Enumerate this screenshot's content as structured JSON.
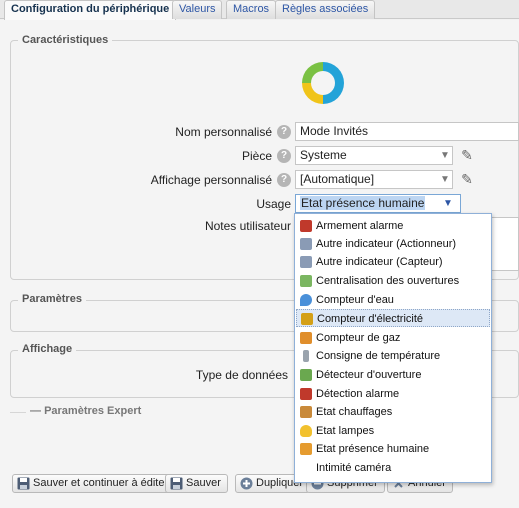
{
  "tabs": [
    {
      "label": "Configuration du périphérique",
      "active": true
    },
    {
      "label": "Valeurs",
      "active": false
    },
    {
      "label": "Macros",
      "active": false
    },
    {
      "label": "Règles associées",
      "active": false
    }
  ],
  "sections": {
    "caracteristiques": "Caractéristiques",
    "parametres": "Paramètres",
    "affichage": "Affichage",
    "expert": "Paramètres Expert"
  },
  "form": {
    "nom_label": "Nom personnalisé",
    "nom_value": "Mode Invités",
    "piece_label": "Pièce",
    "piece_value": "Systeme",
    "affichage_label": "Affichage personnalisé",
    "affichage_value": "[Automatique]",
    "usage_label": "Usage",
    "usage_value": "Etat présence humaine",
    "notes_label": "Notes utilisateur",
    "type_label": "Type de données",
    "help_glyph": "?"
  },
  "usage_options": [
    {
      "label": "Armement alarme",
      "icon": "alarm-arm-icon",
      "color": "#c0392b"
    },
    {
      "label": "Autre indicateur (Actionneur)",
      "icon": "generic-actuator-icon",
      "color": "#8a9bb5"
    },
    {
      "label": "Autre indicateur (Capteur)",
      "icon": "generic-sensor-icon",
      "color": "#8a9bb5"
    },
    {
      "label": "Centralisation des ouvertures",
      "icon": "openings-central-icon",
      "color": "#7bb661"
    },
    {
      "label": "Compteur d'eau",
      "icon": "water-meter-icon",
      "color": "#4a90d9"
    },
    {
      "label": "Compteur d'électricité",
      "icon": "electricity-meter-icon",
      "color": "#d4a017",
      "highlighted": true
    },
    {
      "label": "Compteur de gaz",
      "icon": "gas-meter-icon",
      "color": "#e08e2b"
    },
    {
      "label": "Consigne de température",
      "icon": "thermostat-setpoint-icon",
      "color": "#9aa3ad"
    },
    {
      "label": "Détecteur d'ouverture",
      "icon": "opening-sensor-icon",
      "color": "#6aa84f"
    },
    {
      "label": "Détection alarme",
      "icon": "alarm-detection-icon",
      "color": "#c0392b"
    },
    {
      "label": "Etat chauffages",
      "icon": "heating-icon",
      "color": "#c98a3a"
    },
    {
      "label": "Etat lampes",
      "icon": "lamp-icon",
      "color": "#f2c12e"
    },
    {
      "label": "Etat présence humaine",
      "icon": "presence-icon",
      "color": "#e59b2f"
    },
    {
      "label": "Intimité caméra",
      "icon": "",
      "color": ""
    }
  ],
  "buttons": {
    "save_continue": "Sauver et continuer à éditer",
    "save": "Sauver",
    "duplicate": "Dupliquer",
    "delete": "Supprimer",
    "cancel": "Annuler"
  },
  "colors": {
    "tab_text": "#2d56a5",
    "dropdown_border": "#8fb0d8",
    "selection": "#bcd5f2"
  }
}
